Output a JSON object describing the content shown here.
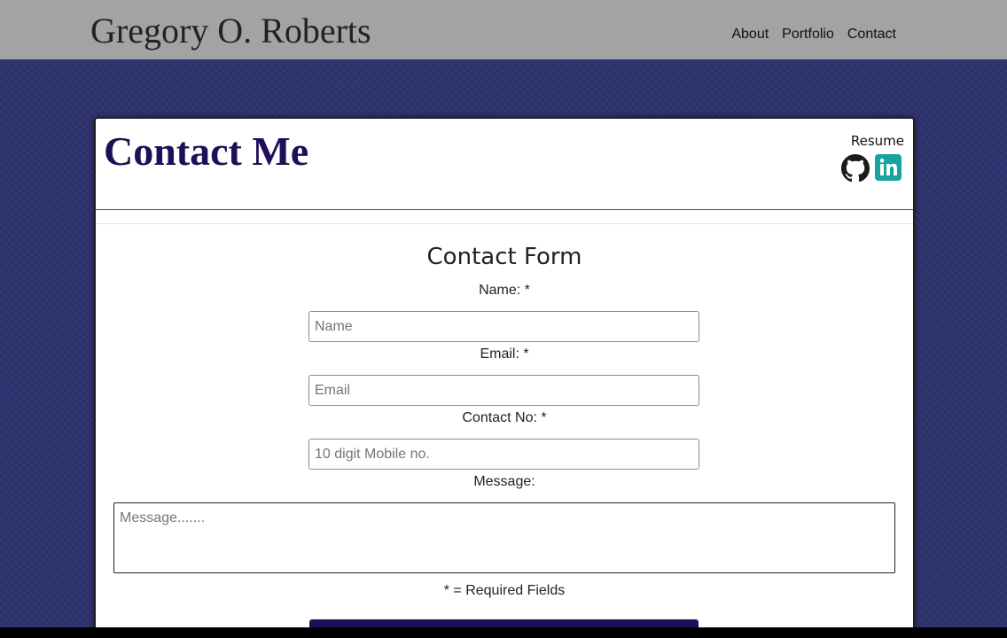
{
  "header": {
    "site_title": "Gregory O. Roberts",
    "nav": [
      "About",
      "Portfolio",
      "Contact"
    ]
  },
  "card": {
    "title": "Contact Me",
    "resume_label": "Resume",
    "social": [
      {
        "icon": "github-icon",
        "color": "#1b1b1b"
      },
      {
        "icon": "linkedin-icon",
        "color": "#18a3a3"
      }
    ]
  },
  "form": {
    "title": "Contact Form",
    "name_label": "Name: *",
    "name_placeholder": "Name",
    "email_label": "Email: *",
    "email_placeholder": "Email",
    "contact_label": "Contact No: *",
    "contact_placeholder": "10 digit Mobile no.",
    "message_label": "Message:",
    "message_placeholder": "Message.......",
    "required_note": "* = Required Fields",
    "submit_label": ""
  },
  "colors": {
    "header_bg": "#a3a3a3",
    "page_bg": "#2f3470",
    "title_color": "#1f0e5a",
    "linkedin": "#18a3a3"
  }
}
